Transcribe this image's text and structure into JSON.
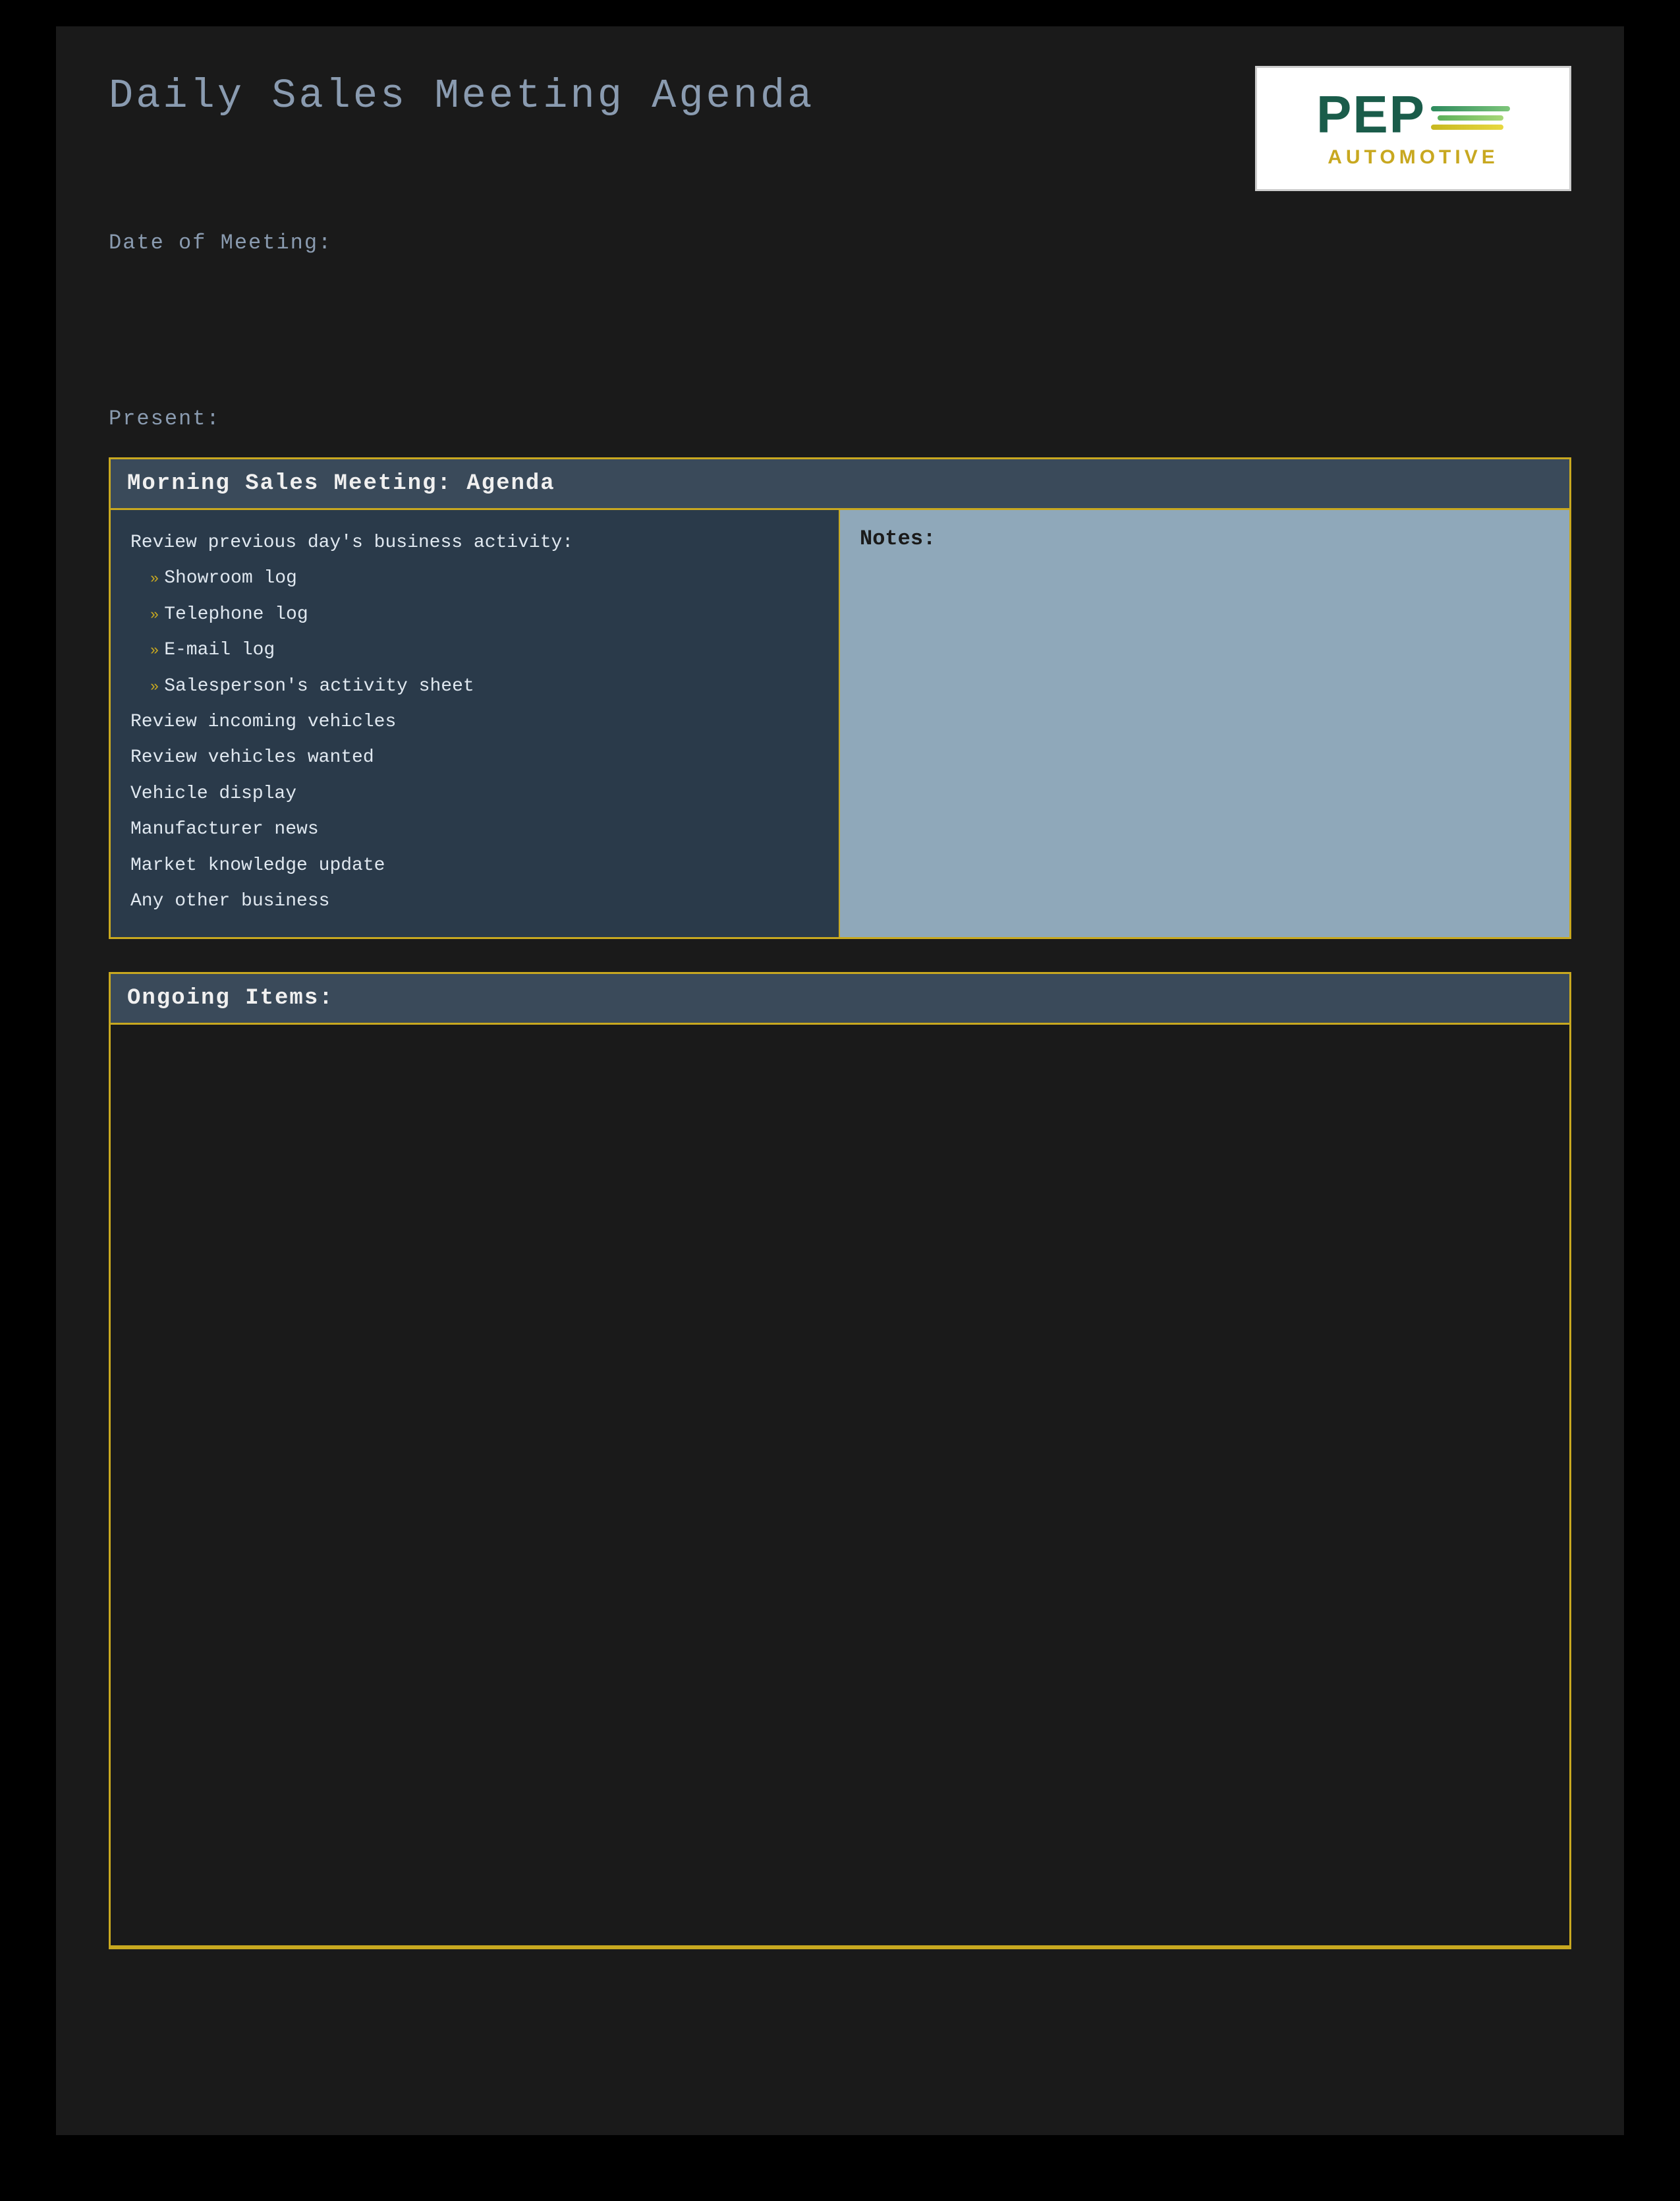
{
  "page": {
    "title": "Daily Sales Meeting Agenda",
    "background": "#1a1a1a"
  },
  "logo": {
    "company": "PEP",
    "tagline": "AUTOMOTIVE"
  },
  "meta": {
    "date_label": "Date of Meeting:",
    "present_label": "Present:"
  },
  "morning_section": {
    "header": "Morning Sales Meeting: Agenda",
    "agenda": {
      "review_title": "Review previous day's business activity:",
      "sub_items": [
        "Showroom log",
        "Telephone log",
        "E-mail log",
        "Salesperson's activity sheet"
      ],
      "main_items": [
        "Review incoming vehicles",
        "Review vehicles wanted",
        "Vehicle display",
        "Manufacturer news",
        "Market knowledge update",
        "Any other business"
      ]
    },
    "notes_label": "Notes:"
  },
  "ongoing_section": {
    "header": "Ongoing Items:"
  },
  "colors": {
    "accent_gold": "#c8a820",
    "header_bg": "#3a4a5a",
    "agenda_bg": "#2a3a4a",
    "notes_bg": "#8fa8ba",
    "text_primary": "#e0e8f0",
    "text_meta": "#8a9bb0"
  }
}
